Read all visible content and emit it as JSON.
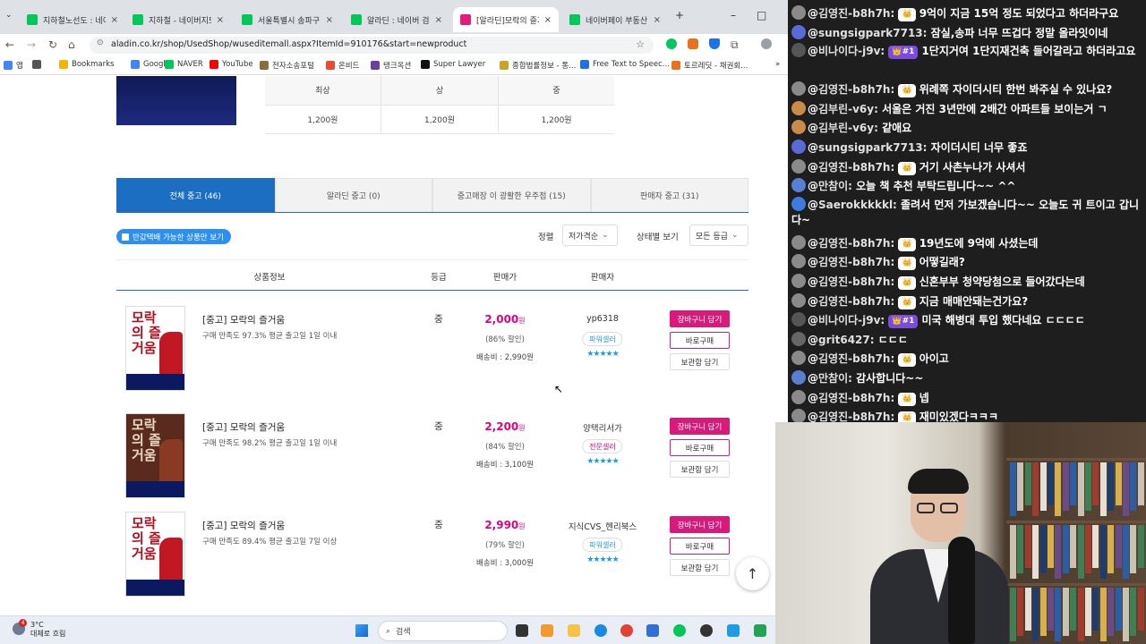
{
  "browser": {
    "tabs": [
      {
        "label": "지하철노선도 : 네이",
        "color": "#03c75a",
        "active": false
      },
      {
        "label": "지하철 - 네이버지도",
        "color": "#03c75a",
        "active": false
      },
      {
        "label": "서울특별시 송파구",
        "color": "#03c75a",
        "active": false
      },
      {
        "label": "알라딘 : 네이버 검색",
        "color": "#03c75a",
        "active": false
      },
      {
        "label": "[알라딘]모락의 즐거",
        "color": "#e01e7a",
        "active": true
      },
      {
        "label": "네이버페이 부동산",
        "color": "#03c75a",
        "active": false
      }
    ],
    "new_tab": "+",
    "url": "aladin.co.kr/shop/UsedShop/wuseditemall.aspx?ItemId=910176&start=newproduct",
    "bookmarks": [
      {
        "label": "앱",
        "color": "#4285f4"
      },
      {
        "label": "",
        "color": "#555555"
      },
      {
        "label": "Bookmarks",
        "color": "#f4b400"
      },
      {
        "label": "Google",
        "color": "#4285f4"
      },
      {
        "label": "NAVER",
        "color": "#03c75a"
      },
      {
        "label": "YouTube",
        "color": "#ff0000"
      },
      {
        "label": "전자소송포털",
        "color": "#8a6d3b"
      },
      {
        "label": "온비드",
        "color": "#e94b35"
      },
      {
        "label": "탱크옥션",
        "color": "#6b3fa0"
      },
      {
        "label": "Super Lawyer",
        "color": "#111111"
      },
      {
        "label": "종합법률정보 - 통...",
        "color": "#c9a227"
      },
      {
        "label": "Free Text to Speec...",
        "color": "#1a73e8"
      },
      {
        "label": "토르레딧 - 채권회...",
        "color": "#e8711a"
      }
    ],
    "bookmarks_more": "»"
  },
  "page": {
    "grade_table": {
      "headers": [
        "최상",
        "상",
        "중"
      ],
      "prices": [
        "1,200원",
        "1,200원",
        "1,200원"
      ]
    },
    "tabs": [
      {
        "label": "전체 중고 (46)",
        "active": true
      },
      {
        "label": "알라딘 중고 (0)",
        "active": false
      },
      {
        "label": "중고매장 이 광활한 우주점 (15)",
        "active": false
      },
      {
        "label": "판매자 중고 (31)",
        "active": false
      }
    ],
    "filter_pill": "반값택배 가능한 상품만 보기",
    "sort_label": "정렬",
    "sort_value": "저가격순",
    "condition_label": "상태별 보기",
    "condition_value": "모든 등급",
    "columns": [
      "상품정보",
      "등급",
      "판매가",
      "판매자"
    ],
    "items": [
      {
        "title": "[중고] 모락의 즐거움",
        "meta": "구매 만족도 97.3%    평균 출고일 1일 이내",
        "grade": "중",
        "price": "2,000",
        "won": "원",
        "discount": "(86% 할인)",
        "shipping": "배송비 : 2,990원",
        "seller": "yp6318",
        "badge": "파워셀러",
        "badge_color": "#1d9be6",
        "stars": "★★★★★",
        "cart": "장바구니 담기",
        "buy": "바로구매",
        "keep": "보관함 담기",
        "cover_title": "모락의 즐거움"
      },
      {
        "title": "[중고] 모락의 즐거움",
        "meta": "구매 만족도 98.2%    평균 출고일 1일 이내",
        "grade": "중",
        "price": "2,200",
        "won": "원",
        "discount": "(84% 할인)",
        "shipping": "배송비 : 3,100원",
        "seller": "양택리서가",
        "badge": "전문셀러",
        "badge_color": "#e3007f",
        "stars": "★★★★★",
        "cart": "장바구니 담기",
        "buy": "바로구매",
        "keep": "보관함 담기",
        "cover_title": "모락의 즐거움"
      },
      {
        "title": "[중고] 모락의 즐거움",
        "meta": "구매 만족도 89.4%    평균 출고일 7일 이상",
        "grade": "중",
        "price": "2,990",
        "won": "원",
        "discount": "(79% 할인)",
        "shipping": "배송비 : 3,000원",
        "seller": "지식CVS_헨리북스",
        "badge": "파워셀러",
        "badge_color": "#1d9be6",
        "stars": "★★★★★",
        "cart": "장바구니 담기",
        "buy": "바로구매",
        "keep": "보관함 담기",
        "cover_title": "모락의 즐거움"
      }
    ],
    "scroll_top": "↑"
  },
  "taskbar": {
    "weather_temp": "3°C",
    "weather_desc": "대체로 흐림",
    "weather_badge": "4",
    "search_placeholder": "검색"
  },
  "chat": {
    "messages": [
      {
        "name": "김영진-b8h7h:",
        "tier": "👑",
        "text": "9억이 지금 15억 정도 되었다고 하더라구요",
        "av": "#8a8a8a"
      },
      {
        "name": "sungsigpark7713:",
        "tier": "",
        "text": "잠실,송파 너무 뜨겁다 정말 올라잇이네",
        "av": "#5b6bd5"
      },
      {
        "name": "비나이다-j9v:",
        "tier": "👑#1",
        "text": "1단지거여 1단지재건축 들어갈라고 하더라고요",
        "av": "#555555",
        "wrap": true
      },
      {
        "name": "김영진-b8h7h:",
        "tier": "👑",
        "text": "위례쪽 자이더시티 한번 봐주실 수 있나요?",
        "av": "#8a8a8a"
      },
      {
        "name": "김부린-v6y:",
        "tier": "",
        "text": "서울은 거진 3년만에 2배간 아파트들 보이는거 ㄱ",
        "av": "#c98a4a"
      },
      {
        "name": "김부린-v6y:",
        "tier": "",
        "text": "같애요",
        "av": "#c98a4a"
      },
      {
        "name": "sungsigpark7713:",
        "tier": "",
        "text": "자이더시티 너무 좋죠",
        "av": "#5b6bd5"
      },
      {
        "name": "김영진-b8h7h:",
        "tier": "👑",
        "text": "거기 사촌누나가 사셔서",
        "av": "#8a8a8a"
      },
      {
        "name": "만참이:",
        "tier": "",
        "text": "오늘 책 추천 부탁드립니다~~ ^^",
        "av": "#5a7fd1"
      },
      {
        "name": "Saerokkkkkl:",
        "tier": "",
        "text": "졸려서 먼저 가보겠습니다~~ 오늘도 귀 트이고 갑니다~",
        "av": "#3d7be0",
        "wrap": true
      },
      {
        "name": "김영진-b8h7h:",
        "tier": "👑",
        "text": "19년도에 9억에 사셨는데",
        "av": "#8a8a8a"
      },
      {
        "name": "김영진-b8h7h:",
        "tier": "👑",
        "text": "어떻길래?",
        "av": "#8a8a8a"
      },
      {
        "name": "김영진-b8h7h:",
        "tier": "👑",
        "text": "신혼부부 청약당첨으로 들어갔다는데",
        "av": "#8a8a8a"
      },
      {
        "name": "김영진-b8h7h:",
        "tier": "👑",
        "text": "지금 매매안돼는건가요?",
        "av": "#8a8a8a"
      },
      {
        "name": "비나이다-j9v:",
        "tier": "👑#1",
        "text": "미국 해병대 투입 했다네요 ㄷㄷㄷㄷ",
        "av": "#555555"
      },
      {
        "name": "grit6427:",
        "tier": "",
        "text": "ㄷㄷㄷ",
        "av": "#666666"
      },
      {
        "name": "김영진-b8h7h:",
        "tier": "👑",
        "text": "아이고",
        "av": "#8a8a8a"
      },
      {
        "name": "만참이:",
        "tier": "",
        "text": "감사합니다~~",
        "av": "#5a7fd1"
      },
      {
        "name": "김영진-b8h7h:",
        "tier": "👑",
        "text": "넵",
        "av": "#8a8a8a"
      },
      {
        "name": "김영진-b8h7h:",
        "tier": "👑",
        "text": "재미있겠다ㅋㅋㅋ",
        "av": "#8a8a8a"
      }
    ]
  }
}
